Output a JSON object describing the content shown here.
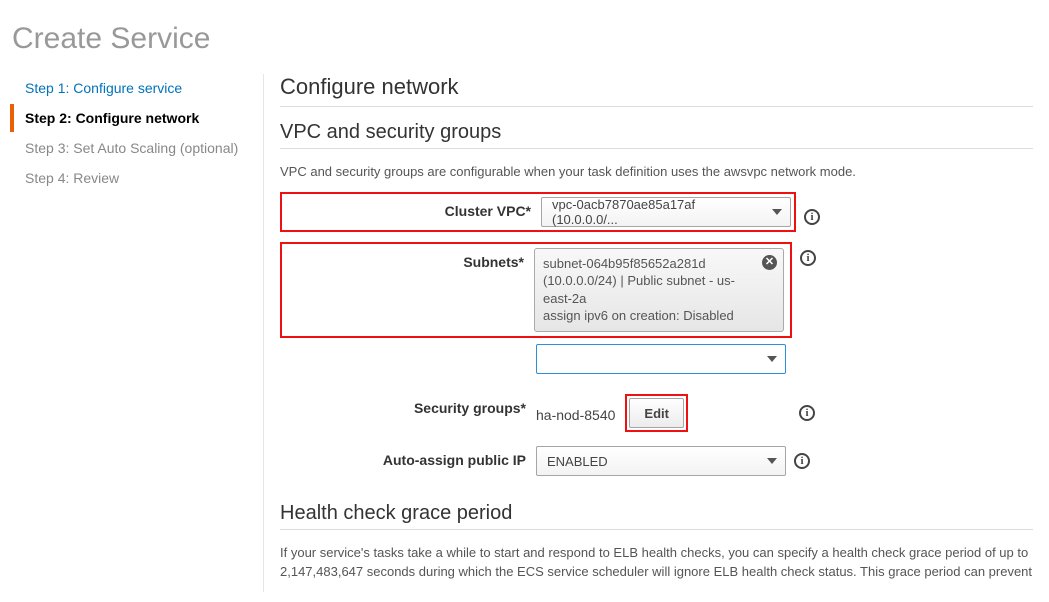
{
  "page_title": "Create Service",
  "steps": [
    {
      "label": "Step 1: Configure service"
    },
    {
      "label": "Step 2: Configure network"
    },
    {
      "label": "Step 3: Set Auto Scaling (optional)"
    },
    {
      "label": "Step 4: Review"
    }
  ],
  "section_title": "Configure network",
  "vpc_section": {
    "title": "VPC and security groups",
    "hint": "VPC and security groups are configurable when your task definition uses the awsvpc network mode.",
    "cluster_vpc_label": "Cluster VPC*",
    "cluster_vpc_value": "vpc-0acb7870ae85a17af (10.0.0.0/...",
    "subnets_label": "Subnets*",
    "subnet_tag_line1": "subnet-064b95f85652a281d",
    "subnet_tag_line2": "(10.0.0.0/24) | Public subnet - us-east-2a",
    "subnet_tag_line3": "assign ipv6 on creation: Disabled",
    "subnets_empty_select": "",
    "security_groups_label": "Security groups*",
    "security_groups_value": "ha-nod-8540",
    "edit_button": "Edit",
    "auto_ip_label": "Auto-assign public IP",
    "auto_ip_value": "ENABLED"
  },
  "health_section": {
    "title": "Health check grace period",
    "text": "If your service's tasks take a while to start and respond to ELB health checks, you can specify a health check grace period of up to 2,147,483,647 seconds during which the ECS service scheduler will ignore ELB health check status. This grace period can prevent"
  }
}
